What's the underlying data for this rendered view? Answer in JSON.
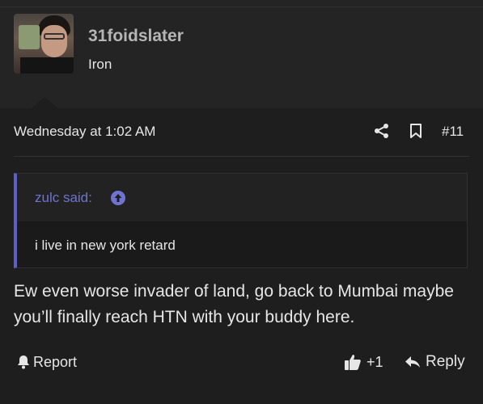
{
  "post": {
    "author": {
      "username": "31foidslater",
      "rank": "Iron"
    },
    "date": "Wednesday at 1:02 AM",
    "number": "#11",
    "quote": {
      "author": "zulc said:",
      "text": "i live in new york retard"
    },
    "message": "Ew even worse invader of land, go back to Mumbai maybe you’ll finally reach HTN with your buddy here.",
    "actions": {
      "report_label": "Report",
      "like_count": "+1",
      "reply_label": "Reply"
    }
  },
  "colors": {
    "quote_accent": "#5b5fc7",
    "background": "#1e1e1e"
  }
}
